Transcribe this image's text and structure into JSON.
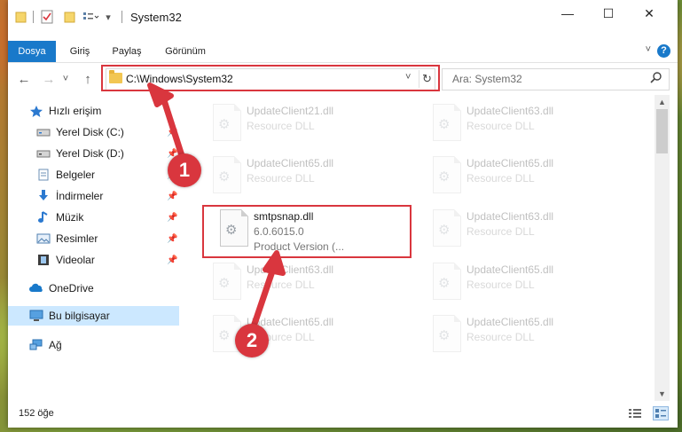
{
  "window": {
    "title": "System32",
    "controls": {
      "minimize": "—",
      "maximize": "☐",
      "close": "✕"
    }
  },
  "ribbon": {
    "tabs": [
      "Dosya",
      "Giriş",
      "Paylaş",
      "Görünüm"
    ],
    "help": "?"
  },
  "navigation": {
    "back_icon": "←",
    "forward_icon": "→",
    "recent_icon": "˅",
    "up_icon": "↑",
    "address_path": "C:\\Windows\\System32",
    "address_dropdown": "˅",
    "refresh_icon": "↻",
    "search_placeholder": "Ara: System32",
    "search_icon": "⚲"
  },
  "sidebar": {
    "items": [
      {
        "label": "Hızlı erişim",
        "icon": "star-icon",
        "pinned": false
      },
      {
        "label": "Yerel Disk (C:)",
        "icon": "drive-icon",
        "pinned": true
      },
      {
        "label": "Yerel Disk (D:)",
        "icon": "drive-icon",
        "pinned": true
      },
      {
        "label": "Belgeler",
        "icon": "documents-icon",
        "pinned": true
      },
      {
        "label": "İndirmeler",
        "icon": "download-icon",
        "pinned": true
      },
      {
        "label": "Müzik",
        "icon": "music-icon",
        "pinned": true
      },
      {
        "label": "Resimler",
        "icon": "pictures-icon",
        "pinned": true
      },
      {
        "label": "Videolar",
        "icon": "video-icon",
        "pinned": true
      },
      {
        "label": "OneDrive",
        "icon": "cloud-icon",
        "pinned": false
      },
      {
        "label": "Bu bilgisayar",
        "icon": "computer-icon",
        "pinned": false,
        "selected": true
      },
      {
        "label": "Ağ",
        "icon": "network-icon",
        "pinned": false
      }
    ],
    "pin_glyph": "📌"
  },
  "files": {
    "left": [
      {
        "name": "UpdateClient21.dll",
        "desc": "Resource DLL",
        "faded": true
      },
      {
        "name": "UpdateClient65.dll",
        "desc": "Resource DLL",
        "faded": true
      },
      {
        "name": "smtpsnap.dll",
        "desc": "6.0.6015.0",
        "desc2": "Product Version    (...",
        "faded": false
      },
      {
        "name": "UpdateClient63.dll",
        "desc": "Resource DLL",
        "faded": true
      },
      {
        "name": "UpdateClient65.dll",
        "desc": "Resource DLL",
        "faded": true
      }
    ],
    "right": [
      {
        "name": "UpdateClient63.dll",
        "desc": "Resource DLL",
        "faded": true
      },
      {
        "name": "UpdateClient65.dll",
        "desc": "Resource DLL",
        "faded": true
      },
      {
        "name": "UpdateClient63.dll",
        "desc": "Resource DLL",
        "faded": true
      },
      {
        "name": "UpdateClient65.dll",
        "desc": "Resource DLL",
        "faded": true
      },
      {
        "name": "UpdateClient65.dll",
        "desc": "Resource DLL",
        "faded": true
      }
    ]
  },
  "status": {
    "item_count": "152 öğe"
  },
  "callouts": [
    "1",
    "2"
  ],
  "colors": {
    "accent": "#1979ca",
    "highlight": "#d9363e",
    "selected": "#cce8ff"
  }
}
